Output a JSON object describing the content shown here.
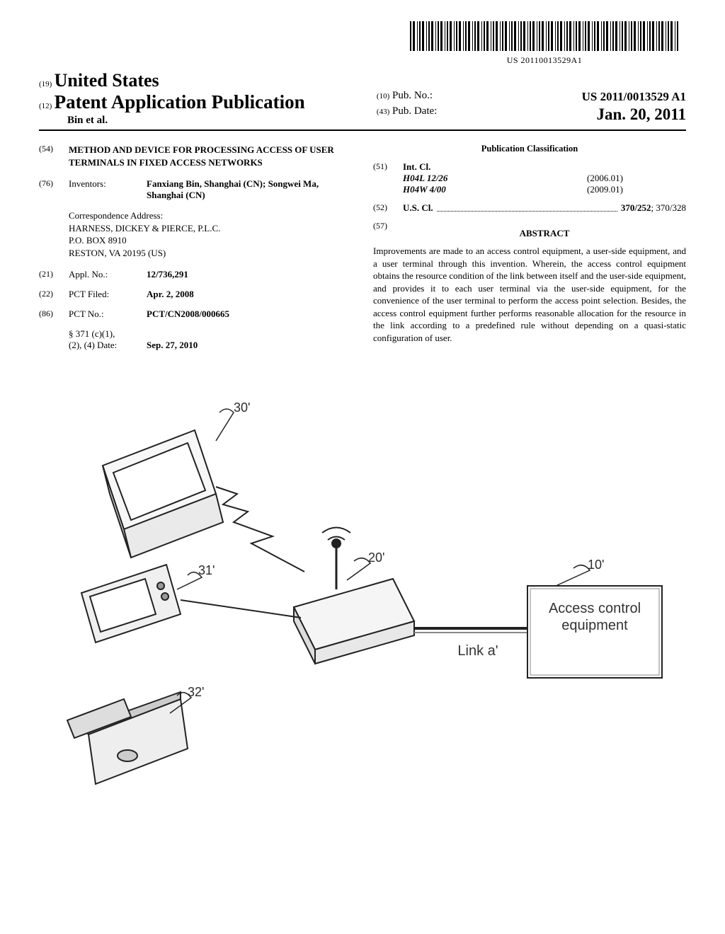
{
  "barcode_number": "US 20110013529A1",
  "header": {
    "ref19": "(19)",
    "country": "United States",
    "ref12": "(12)",
    "pub_type": "Patent Application Publication",
    "authors": "Bin et al.",
    "ref10": "(10)",
    "pub_no_label": "Pub. No.:",
    "pub_no": "US 2011/0013529 A1",
    "ref43": "(43)",
    "pub_date_label": "Pub. Date:",
    "pub_date": "Jan. 20, 2011"
  },
  "title": {
    "code": "(54)",
    "text": "METHOD AND DEVICE FOR PROCESSING ACCESS OF USER TERMINALS IN FIXED ACCESS NETWORKS"
  },
  "inventors": {
    "code": "(76)",
    "label": "Inventors:",
    "value": "Fanxiang Bin, Shanghai (CN); Songwei Ma, Shanghai (CN)"
  },
  "correspondence": {
    "label": "Correspondence Address:",
    "line1": "HARNESS, DICKEY & PIERCE, P.L.C.",
    "line2": "P.O. BOX 8910",
    "line3": "RESTON, VA 20195 (US)"
  },
  "appl_no": {
    "code": "(21)",
    "label": "Appl. No.:",
    "value": "12/736,291"
  },
  "pct_filed": {
    "code": "(22)",
    "label": "PCT Filed:",
    "value": "Apr. 2, 2008"
  },
  "pct_no": {
    "code": "(86)",
    "label": "PCT No.:",
    "value": "PCT/CN2008/000665"
  },
  "s371": {
    "label1": "§ 371 (c)(1),",
    "label2": "(2), (4) Date:",
    "value": "Sep. 27, 2010"
  },
  "pub_class": {
    "heading": "Publication Classification"
  },
  "intcl": {
    "code": "(51)",
    "label": "Int. Cl.",
    "rows": [
      {
        "cls": "H04L 12/26",
        "ver": "(2006.01)"
      },
      {
        "cls": "H04W 4/00",
        "ver": "(2009.01)"
      }
    ]
  },
  "uscl": {
    "code": "(52)",
    "label": "U.S. Cl.",
    "value_bold": "370/252",
    "value_rest": "; 370/328"
  },
  "abstract": {
    "code": "(57)",
    "heading": "ABSTRACT",
    "body": "Improvements are made to an access control equipment, a user-side equipment, and a user terminal through this invention. Wherein, the access control equipment obtains the resource condition of the link between itself and the user-side equipment, and provides it to each user terminal via the user-side equipment, for the convenience of the user terminal to perform the access point selection. Besides, the access control equipment further performs reasonable allocation for the resource in the link according to a predefined rule without depending on a quasi-static configuration of user."
  },
  "figure": {
    "n30": "30'",
    "n31": "31'",
    "n32": "32'",
    "n20": "20'",
    "n10": "10'",
    "link": "Link a'",
    "box": "Access control equipment"
  }
}
